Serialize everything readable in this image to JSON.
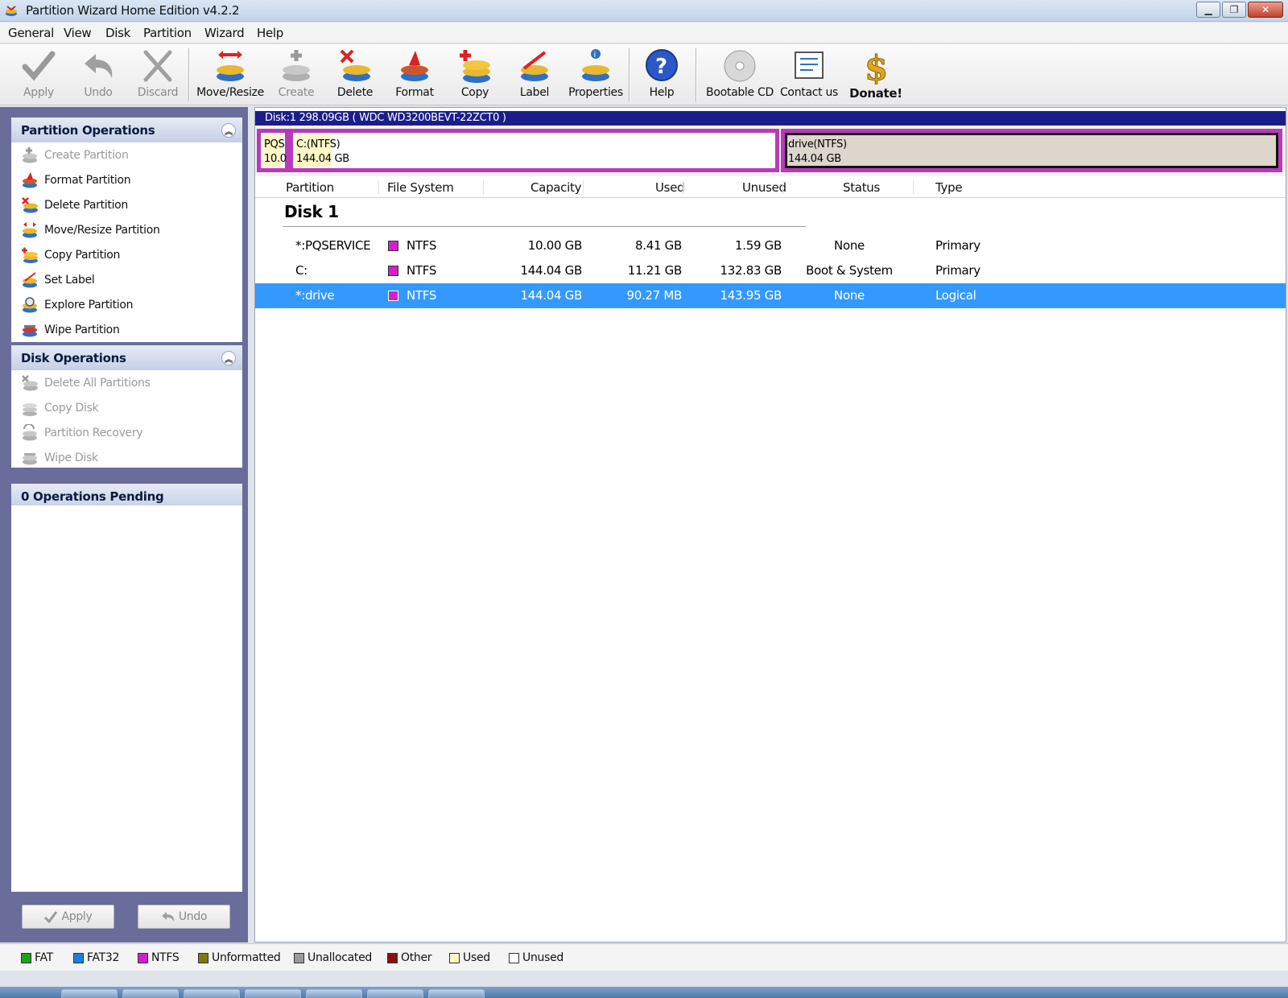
{
  "window": {
    "title": "Partition Wizard Home Edition v4.2.2"
  },
  "menu": [
    "General",
    "View",
    "Disk",
    "Partition",
    "Wizard",
    "Help"
  ],
  "toolbar": {
    "apply": "Apply",
    "undo": "Undo",
    "discard": "Discard",
    "move_resize": "Move/Resize",
    "create": "Create",
    "delete": "Delete",
    "format": "Format",
    "copy": "Copy",
    "label": "Label",
    "properties": "Properties",
    "help": "Help",
    "bootable_cd": "Bootable CD",
    "contact_us": "Contact us",
    "donate": "Donate!"
  },
  "sidebar": {
    "partition_ops": {
      "title": "Partition Operations",
      "items": [
        "Create Partition",
        "Format Partition",
        "Delete Partition",
        "Move/Resize Partition",
        "Copy Partition",
        "Set Label",
        "Explore Partition",
        "Wipe Partition"
      ]
    },
    "disk_ops": {
      "title": "Disk Operations",
      "items": [
        "Delete All Partitions",
        "Copy Disk",
        "Partition Recovery",
        "Wipe Disk"
      ]
    },
    "pending": {
      "title": "0 Operations Pending"
    },
    "apply_btn": "Apply",
    "undo_btn": "Undo"
  },
  "diskmap": {
    "header": "Disk:1 298.09GB  ( WDC WD3200BEVT-22ZCT0 )",
    "partitions": [
      {
        "name": "PQS",
        "size": "10.0",
        "used_fraction": 0.84
      },
      {
        "name": "C:(NTFS)",
        "size": "144.04 GB",
        "used_fraction": 0.08
      },
      {
        "name": "drive(NTFS)",
        "size": "144.04 GB",
        "used_fraction": 0.0
      }
    ]
  },
  "table": {
    "columns": [
      "Partition",
      "File System",
      "Capacity",
      "Used",
      "Unused",
      "Status",
      "Type"
    ],
    "disk_label": "Disk 1",
    "rows": [
      {
        "partition": "*:PQSERVICE",
        "fs": "NTFS",
        "capacity": "10.00 GB",
        "used": "8.41 GB",
        "unused": "1.59 GB",
        "status": "None",
        "type": "Primary"
      },
      {
        "partition": "C:",
        "fs": "NTFS",
        "capacity": "144.04 GB",
        "used": "11.21 GB",
        "unused": "132.83 GB",
        "status": "Boot & System",
        "type": "Primary"
      },
      {
        "partition": "*:drive",
        "fs": "NTFS",
        "capacity": "144.04 GB",
        "used": "90.27 MB",
        "unused": "143.95 GB",
        "status": "None",
        "type": "Logical"
      }
    ]
  },
  "legend": [
    {
      "label": "FAT",
      "color": "#1aa31a"
    },
    {
      "label": "FAT32",
      "color": "#1e7fdc"
    },
    {
      "label": "NTFS",
      "color": "#d21fcf"
    },
    {
      "label": "Unformatted",
      "color": "#7a7a10"
    },
    {
      "label": "Unallocated",
      "color": "#9a9a9a"
    },
    {
      "label": "Other",
      "color": "#8a1010"
    },
    {
      "label": "Used",
      "color": "#fbf7c6"
    },
    {
      "label": "Unused",
      "color": "#ffffff"
    }
  ],
  "colors": {
    "accent_selection": "#3399ff",
    "disk_header": "#1b1e8a",
    "partition_border": "#b83ab8",
    "sidebar_bg": "#6a6d9a"
  }
}
